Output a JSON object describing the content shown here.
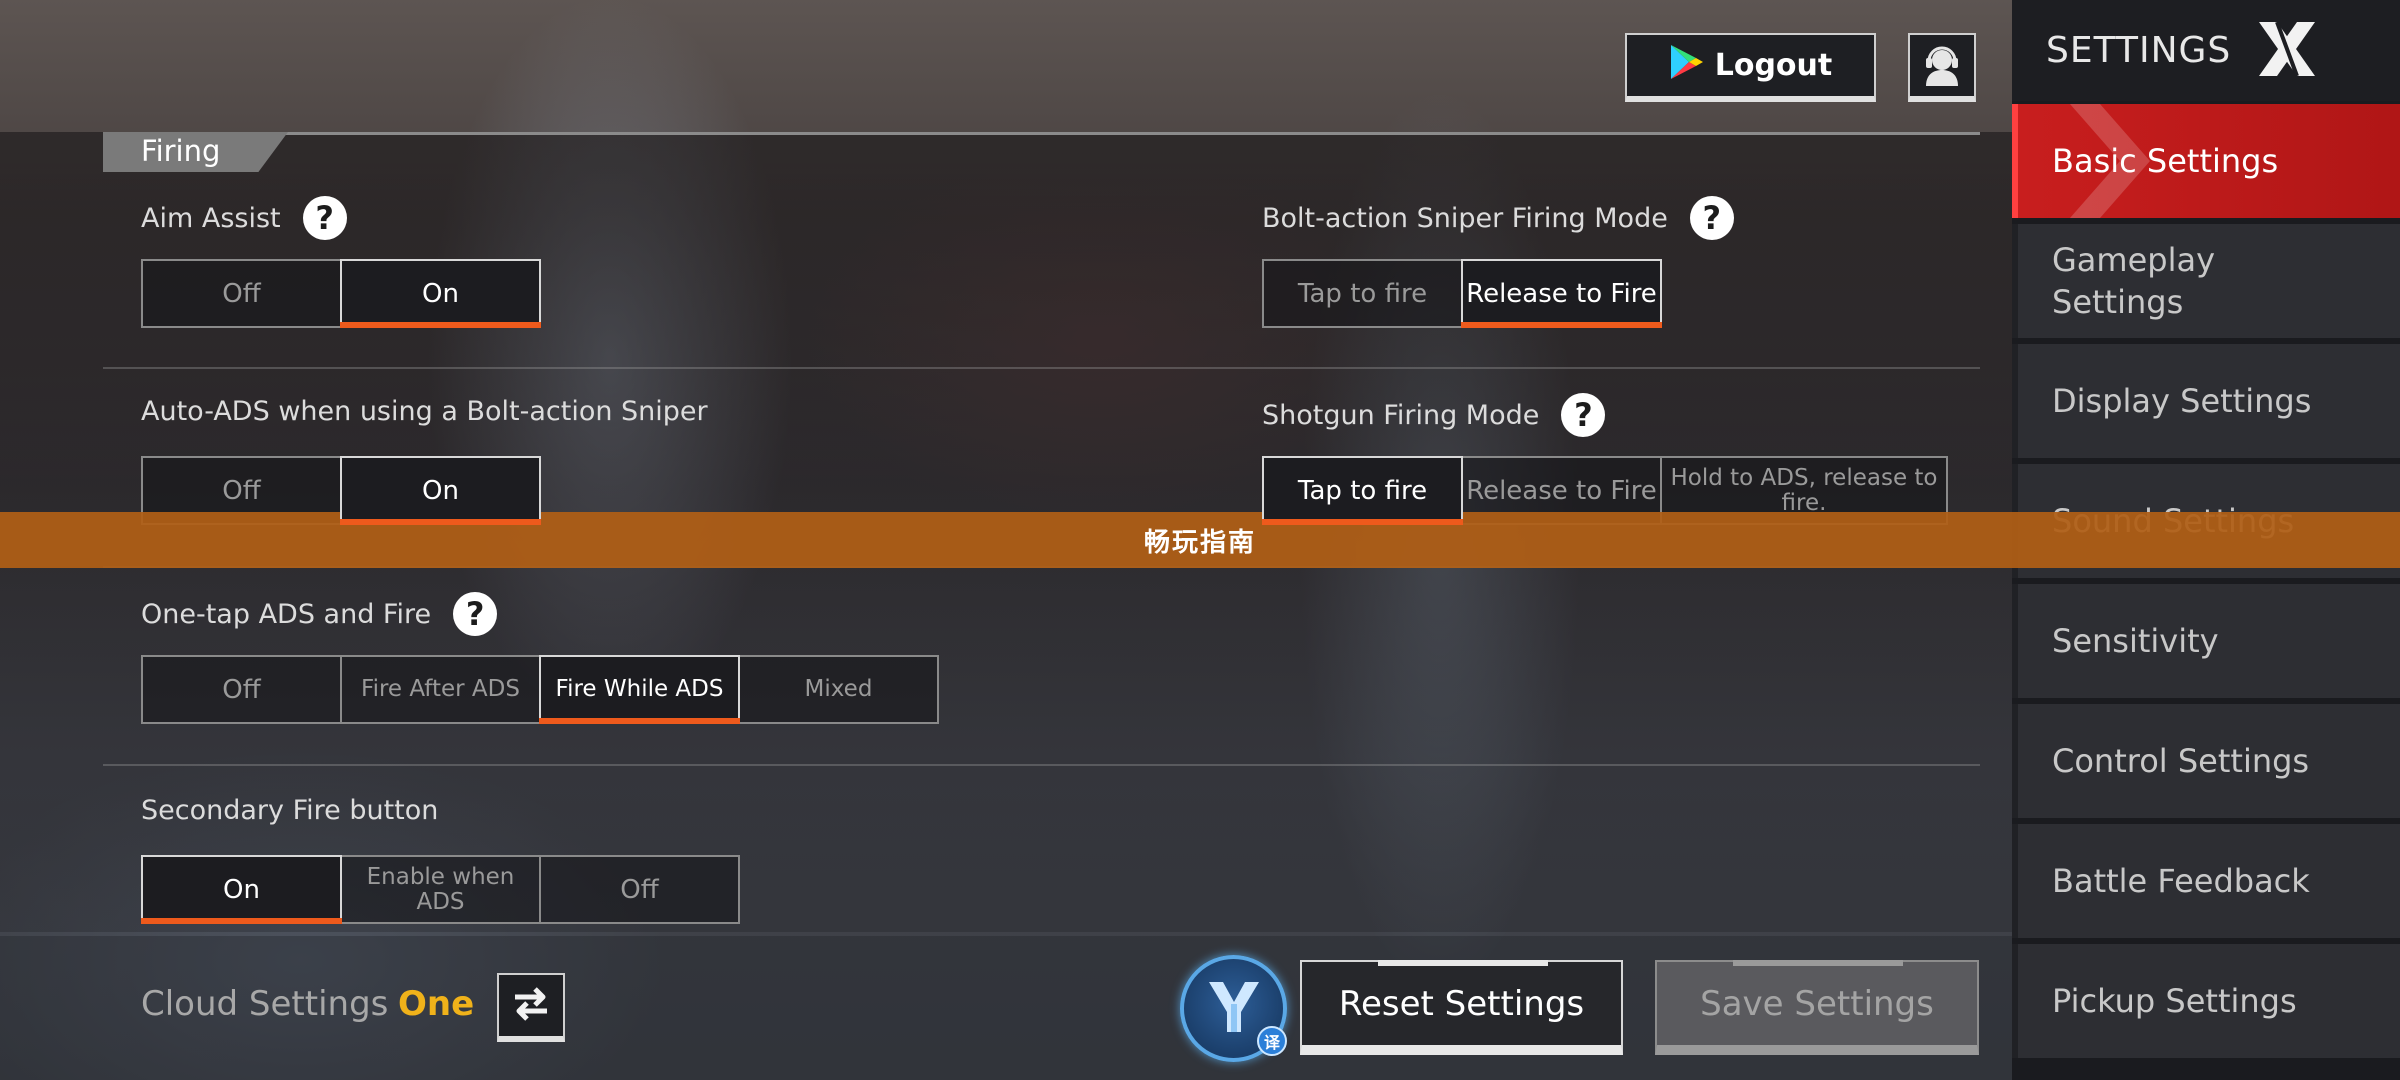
{
  "header": {
    "logout_label": "Logout",
    "support_icon": "headset-support-icon"
  },
  "section": {
    "title": "Firing"
  },
  "settings": {
    "aim_assist": {
      "label": "Aim Assist",
      "options": [
        "Off",
        "On"
      ],
      "selected": "On"
    },
    "bolt_action_firing_mode": {
      "label": "Bolt-action Sniper Firing Mode",
      "options": [
        "Tap to fire",
        "Release to Fire"
      ],
      "selected": "Release to Fire"
    },
    "auto_ads": {
      "label": "Auto-ADS when using a Bolt-action Sniper",
      "options": [
        "Off",
        "On"
      ],
      "selected": "On"
    },
    "shotgun_firing_mode": {
      "label": "Shotgun Firing Mode",
      "options": [
        "Tap to fire",
        "Release to Fire",
        "Hold to ADS, release to fire."
      ],
      "selected": "Tap to fire"
    },
    "one_tap_ads": {
      "label": "One-tap ADS and Fire",
      "options": [
        "Off",
        "Fire After ADS",
        "Fire While ADS",
        "Mixed"
      ],
      "selected": "Fire While ADS"
    },
    "secondary_fire": {
      "label": "Secondary Fire button",
      "options": [
        "On",
        "Enable when ADS",
        "Off"
      ],
      "selected": "On"
    }
  },
  "footer": {
    "cloud_label": "Cloud Settings",
    "cloud_value": "One",
    "translate_tag": "译",
    "reset_label": "Reset Settings",
    "save_label": "Save Settings"
  },
  "sidebar": {
    "title": "SETTINGS",
    "items": [
      {
        "label": "Basic Settings",
        "active": true
      },
      {
        "label": "Gameplay Settings",
        "active": false
      },
      {
        "label": "Display Settings",
        "active": false
      },
      {
        "label": "Sound Settings",
        "active": false
      },
      {
        "label": "Sensitivity",
        "active": false
      },
      {
        "label": "Control Settings",
        "active": false
      },
      {
        "label": "Battle Feedback",
        "active": false
      },
      {
        "label": "Pickup Settings",
        "active": false
      }
    ]
  },
  "banner": {
    "text": "畅玩指南"
  },
  "colors": {
    "accent_orange": "#ee5a1c",
    "active_red": "#c81e1e",
    "cloud_yellow": "#f0b21a",
    "banner_orange": "#b05f16"
  }
}
